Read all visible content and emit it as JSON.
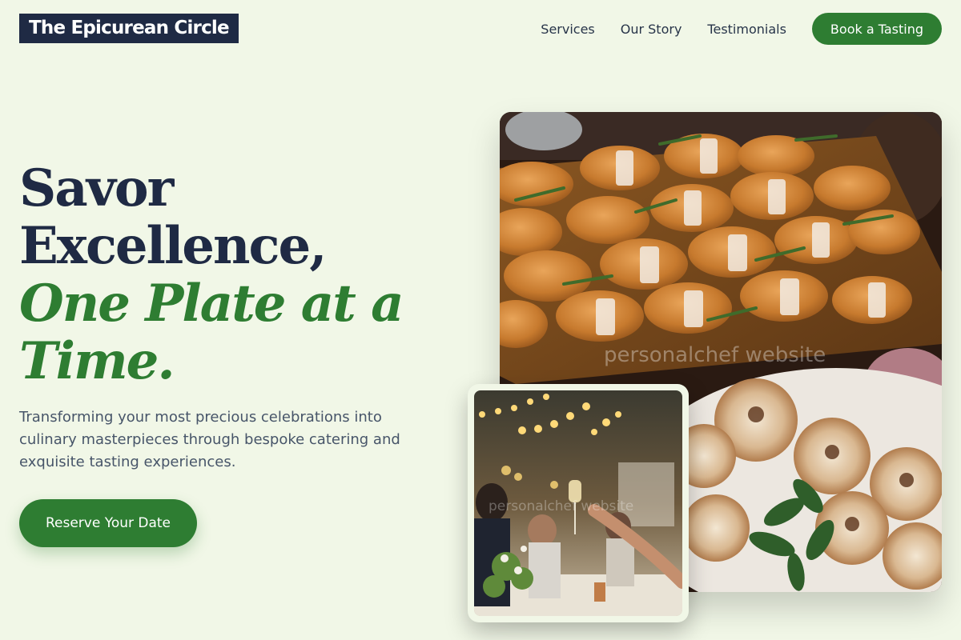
{
  "header": {
    "logo": "The Epicurean Circle",
    "nav": {
      "services": "Services",
      "our_story": "Our Story",
      "testimonials": "Testimonials"
    },
    "cta": "Book a Tasting"
  },
  "hero": {
    "headline_line1": "Savor",
    "headline_line2": "Excellence,",
    "headline_accent_line1": "One Plate at a",
    "headline_accent_line2": "Time.",
    "subtitle": "Transforming your most precious celebrations into culinary masterpieces through bespoke catering and exquisite tasting experiences.",
    "cta": "Reserve Your Date"
  },
  "images": {
    "main_watermark": "personalchef website",
    "small_watermark": "personalchef website"
  },
  "colors": {
    "background": "#f1f7e7",
    "primary": "#2e7d32",
    "dark": "#1f2a44",
    "text_muted": "#475569"
  },
  "icons": {}
}
